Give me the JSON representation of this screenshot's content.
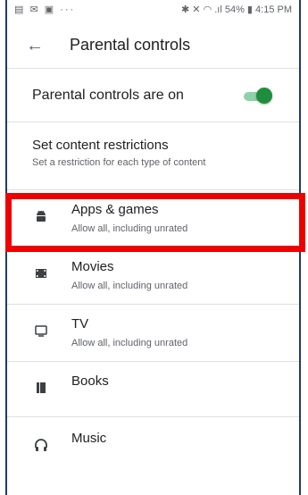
{
  "status_bar": {
    "left": "▤ ✉ ▣ ···",
    "right": "✱ ✕ ◠ .ıl 54% ▮ 4:15 PM"
  },
  "app_bar": {
    "title": "Parental controls",
    "back_icon": "arrow-back-icon"
  },
  "toggle": {
    "label": "Parental controls are on",
    "state": "on",
    "color": "#1e8e3e"
  },
  "restrictions": {
    "heading": "Set content restrictions",
    "subheading": "Set a restriction for each type of content"
  },
  "items": [
    {
      "name": "Apps & games",
      "desc": "Allow all, including unrated",
      "icon": "android-icon"
    },
    {
      "name": "Movies",
      "desc": "Allow all, including unrated",
      "icon": "film-icon"
    },
    {
      "name": "TV",
      "desc": "Allow all, including unrated",
      "icon": "tv-icon"
    },
    {
      "name": "Books",
      "desc": "",
      "icon": "book-icon"
    },
    {
      "name": "Music",
      "desc": "",
      "icon": "headphones-icon"
    }
  ],
  "highlight_color": "#ee0000"
}
